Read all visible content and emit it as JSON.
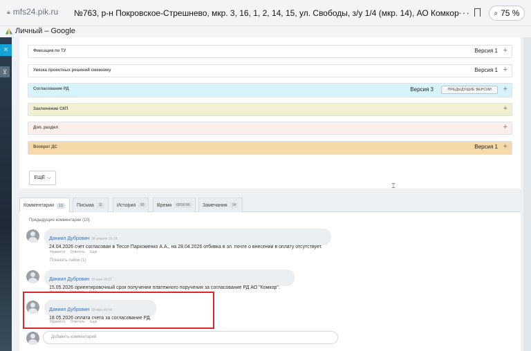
{
  "browser": {
    "domain": "mfs24.pik.ru",
    "title": "№763, р-н Покровское-Стрешнево, мкр. 3, 16, 1, 2, 14, 15, ул. Свободы, з/у 1/4 (мкр. 14), АО Комкор",
    "menu_glyph": "···",
    "zoom": "75 %",
    "tab_label": "Личный – Google"
  },
  "sidebar": {
    "close_glyph": "×",
    "toggle_glyph": "⊻"
  },
  "sections": [
    {
      "label": "Фиксация по ТУ",
      "version": "Версия 1",
      "color": "#ffffff"
    },
    {
      "label": "Увязка проектных решений смежнику",
      "version": "Версия 1",
      "color": "#ffffff"
    },
    {
      "label": "Согласование РД",
      "version": "Версия 3",
      "prev_button": "ПРЕДЫДУЩИЕ ВЕРСИИ",
      "color": "#d6f4fa"
    },
    {
      "label": "Заключение СКП",
      "version": "",
      "color": "#f2f0d0"
    },
    {
      "label": "Доп. раздел",
      "version": "",
      "color": "#fcefe9"
    },
    {
      "label": "Возврат ДС",
      "version": "Версия 1",
      "color": "#f5d9a8"
    }
  ],
  "more_button": "ЕЩЁ",
  "tabs": [
    {
      "label": "Комментарии",
      "count": "13"
    },
    {
      "label": "Письма",
      "count": "11"
    },
    {
      "label": "История",
      "count": "93"
    },
    {
      "label": "Время",
      "count": "00:00:00"
    },
    {
      "label": "Замечания",
      "count": "14"
    }
  ],
  "comments_panel": {
    "previous_link": "Предыдущие комментарии (10)",
    "comments": [
      {
        "author": "Даниил Дубровин",
        "time": "28 апреля 15:14",
        "text": "24.04.2026 счет согласован в Тессе Пархоменко А.А., на 28.04.2026 отбивка в эл. почте о внесении в оплату отсутствует.",
        "actions": [
          "Нравится",
          "Ответить",
          "Ещё"
        ],
        "likes": "Показать лайки (1)"
      },
      {
        "author": "Даниил Дубровин",
        "time": "15 мая 16:27",
        "text": "15.05.2026 ориентировочный срок получения платежного поручения за согласование РД АО \"Комкор\".",
        "actions": [
          "Нравится",
          "Ответить",
          "Ещё"
        ]
      },
      {
        "author": "Даниил Дубровин",
        "time": "18 мая 09:04",
        "text": "18.05.2026 оплата счета за согласование РД.",
        "actions": [
          "Нравится",
          "Ответить",
          "Ещё"
        ]
      }
    ],
    "add_placeholder": "Добавить комментарий"
  },
  "colors": {
    "accent_highlight": "#d9262a",
    "link": "#3f6fb0"
  }
}
